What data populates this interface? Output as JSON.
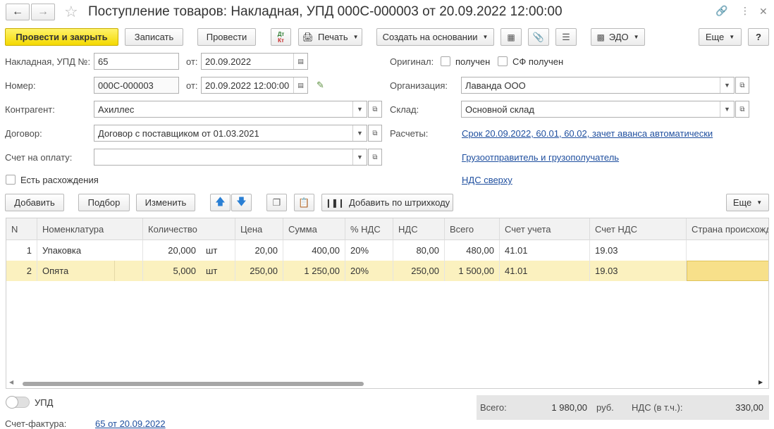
{
  "window": {
    "title": "Поступление товаров: Накладная, УПД 000С-000003 от 20.09.2022 12:00:00"
  },
  "toolbar": {
    "post_close": "Провести и закрыть",
    "save": "Записать",
    "post": "Провести",
    "dtkt_top": "Дт",
    "dtkt_bottom": "Кт",
    "print": "Печать",
    "create_based": "Создать на основании",
    "edo": "ЭДО",
    "more": "Еще",
    "help": "?"
  },
  "form": {
    "invoice_label": "Накладная, УПД №:",
    "invoice_number": "65",
    "from_label": "от:",
    "invoice_date": "20.09.2022",
    "number_label": "Номер:",
    "number_value": "000С-000003",
    "number_date": "20.09.2022 12:00:00",
    "counterparty_label": "Контрагент:",
    "counterparty_value": "Ахиллес",
    "contract_label": "Договор:",
    "contract_value": "Договор с поставщиком от 01.03.2021",
    "payment_label": "Счет на оплату:",
    "payment_value": "",
    "discrepancy_label": "Есть расхождения",
    "original_label": "Оригинал:",
    "original_received": "получен",
    "sf_received": "СФ получен",
    "org_label": "Организация:",
    "org_value": "Лаванда ООО",
    "warehouse_label": "Склад:",
    "warehouse_value": "Основной склад",
    "settlements_label": "Расчеты:",
    "settlements_link": "Срок 20.09.2022, 60.01, 60.02, зачет аванса автоматически",
    "shipper_link": "Грузоотправитель и грузополучатель",
    "vat_link": "НДС сверху"
  },
  "table_toolbar": {
    "add": "Добавить",
    "pick": "Подбор",
    "change": "Изменить",
    "barcode": "Добавить по штрихкоду",
    "more": "Еще"
  },
  "table": {
    "headers": [
      "N",
      "Номенклатура",
      "Количество",
      "Цена",
      "Сумма",
      "% НДС",
      "НДС",
      "Всего",
      "Счет учета",
      "Счет НДС",
      "Страна происхожд"
    ],
    "rows": [
      {
        "n": "1",
        "item": "Упаковка",
        "qty": "20,000",
        "unit": "шт",
        "price": "20,00",
        "sum": "400,00",
        "vat_rate": "20%",
        "vat": "80,00",
        "total": "480,00",
        "account": "41.01",
        "vat_account": "19.03",
        "country": ""
      },
      {
        "n": "2",
        "item": "Опята",
        "qty": "5,000",
        "unit": "шт",
        "price": "250,00",
        "sum": "1 250,00",
        "vat_rate": "20%",
        "vat": "250,00",
        "total": "1 500,00",
        "account": "41.01",
        "vat_account": "19.03",
        "country": ""
      }
    ]
  },
  "footer": {
    "upd_label": "УПД",
    "invoice_label": "Счет-фактура:",
    "invoice_link": "65 от 20.09.2022",
    "total_label": "Всего:",
    "total_value": "1 980,00",
    "currency": "руб.",
    "vat_label": "НДС (в т.ч.):",
    "vat_value": "330,00"
  },
  "colors": {
    "primary_button": "#f4d900",
    "link": "#1f4f9f",
    "selected_row": "#fbf1bf"
  }
}
